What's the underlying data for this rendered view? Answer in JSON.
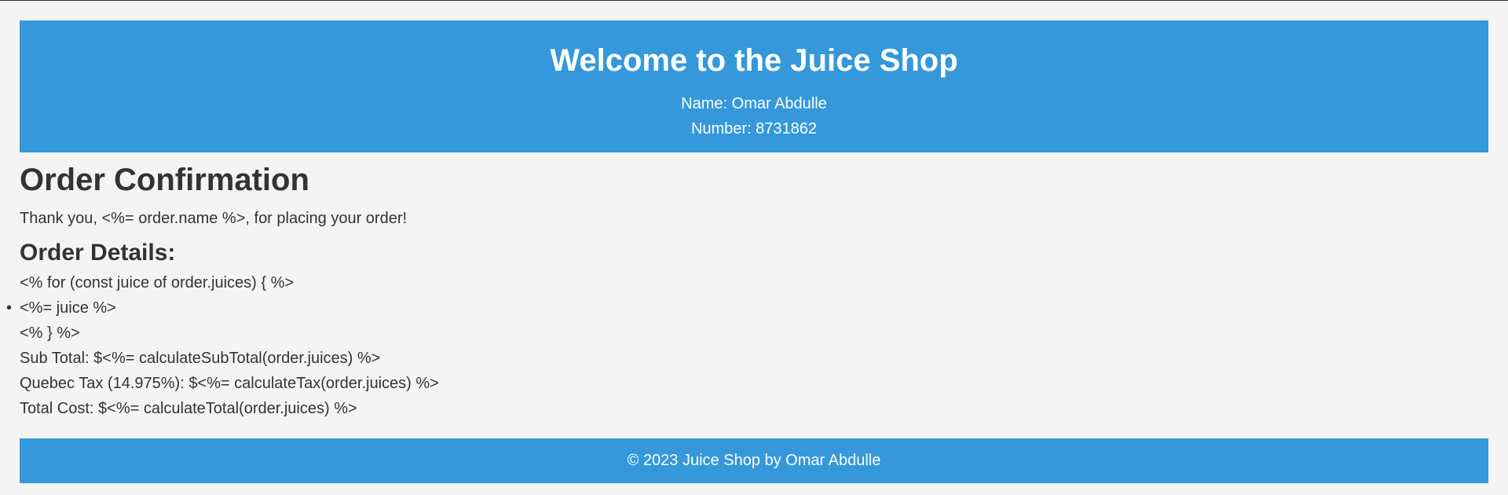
{
  "header": {
    "title": "Welcome to the Juice Shop",
    "name_line": "Name: Omar Abdulle",
    "number_line": "Number: 8731862"
  },
  "main": {
    "title": "Order Confirmation",
    "thanks": "Thank you, <%= order.name %>, for placing your order!",
    "details_title": "Order Details:",
    "loop_start": "<% for (const juice of order.juices) { %>",
    "juice_item": "<%= juice %>",
    "loop_end": "<% } %>",
    "subtotal": "Sub Total: $<%= calculateSubTotal(order.juices) %>",
    "tax": "Quebec Tax (14.975%): $<%= calculateTax(order.juices) %>",
    "total": "Total Cost: $<%= calculateTotal(order.juices) %>"
  },
  "footer": {
    "text": "© 2023 Juice Shop by Omar Abdulle"
  },
  "colors": {
    "accent": "#3498db",
    "background": "#f4f4f4",
    "text": "#333333",
    "header_text": "#ffffff"
  }
}
